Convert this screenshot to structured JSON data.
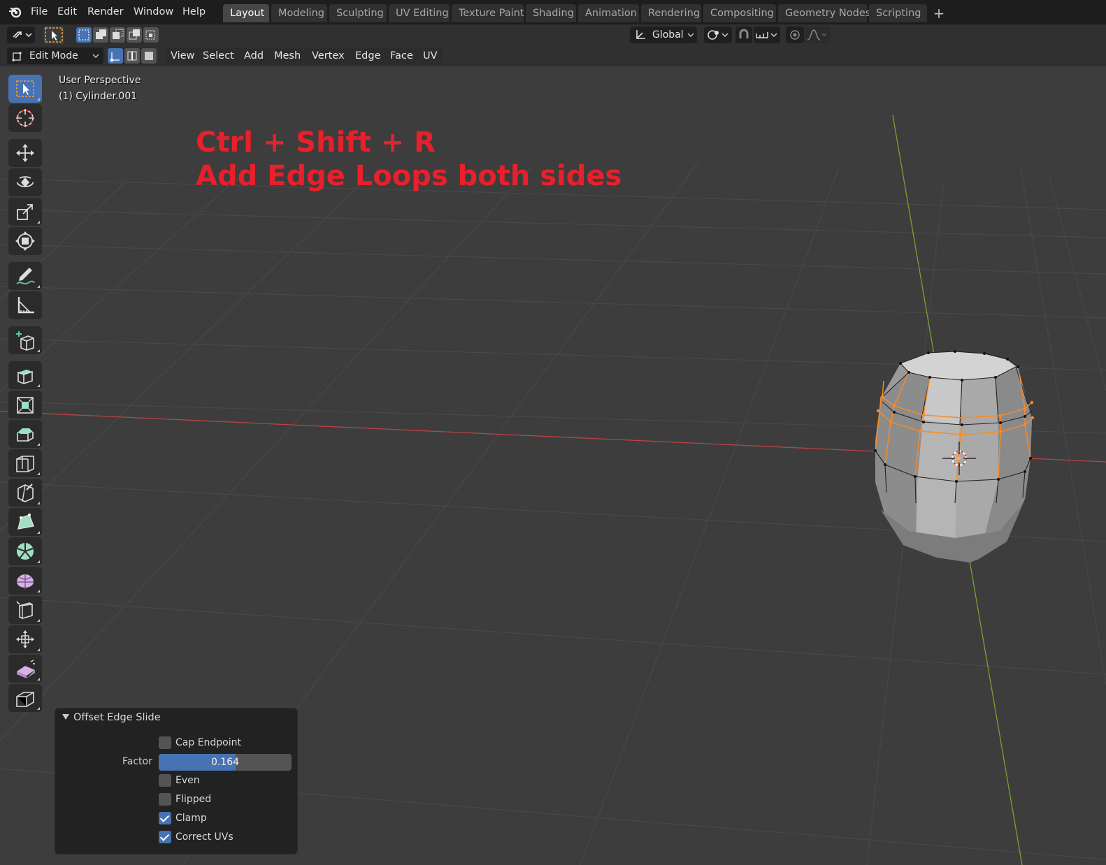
{
  "menubar": {
    "items": [
      "File",
      "Edit",
      "Render",
      "Window",
      "Help"
    ]
  },
  "workspaces": {
    "tabs": [
      "Layout",
      "Modeling",
      "Sculpting",
      "UV Editing",
      "Texture Paint",
      "Shading",
      "Animation",
      "Rendering",
      "Compositing",
      "Geometry Nodes",
      "Scripting"
    ],
    "active": "Layout",
    "add_label": "+"
  },
  "header": {
    "transform_orientation": "Global"
  },
  "mode_header": {
    "mode": "Edit Mode",
    "menus": [
      "View",
      "Select",
      "Add",
      "Mesh",
      "Vertex",
      "Edge",
      "Face",
      "UV"
    ]
  },
  "viewport": {
    "view_name": "User Perspective",
    "object_name": "(1) Cylinder.001",
    "annotation_line1": "Ctrl + Shift + R",
    "annotation_line2": "Add Edge Loops both sides",
    "annotation_color": "#e8202c"
  },
  "toolbar": {
    "tools": [
      "select-box-icon",
      "cursor-icon",
      "move-icon",
      "rotate-icon",
      "scale-icon",
      "transform-icon",
      "annotate-icon",
      "measure-icon",
      "add-cube-icon",
      "extrude-region-icon",
      "inset-faces-icon",
      "bevel-icon",
      "loop-cut-icon",
      "knife-icon",
      "poly-build-icon",
      "spin-icon",
      "smooth-icon",
      "edge-slide-icon",
      "shrink-fatten-icon",
      "shear-icon",
      "rip-region-icon"
    ],
    "active_tool": "select-box-icon"
  },
  "operator_panel": {
    "title": "Offset Edge Slide",
    "cap_endpoint": {
      "label": "Cap Endpoint",
      "checked": false
    },
    "factor": {
      "label": "Factor",
      "value": "0.164",
      "fraction": 0.58
    },
    "even": {
      "label": "Even",
      "checked": false
    },
    "flipped": {
      "label": "Flipped",
      "checked": false
    },
    "clamp": {
      "label": "Clamp",
      "checked": true
    },
    "correct_uvs": {
      "label": "Correct UVs",
      "checked": true
    }
  },
  "colors": {
    "accent": "#4772b3",
    "selection": "#ff8a1e",
    "x_axis": "#c83c3c",
    "y_axis": "#7aa32a"
  }
}
